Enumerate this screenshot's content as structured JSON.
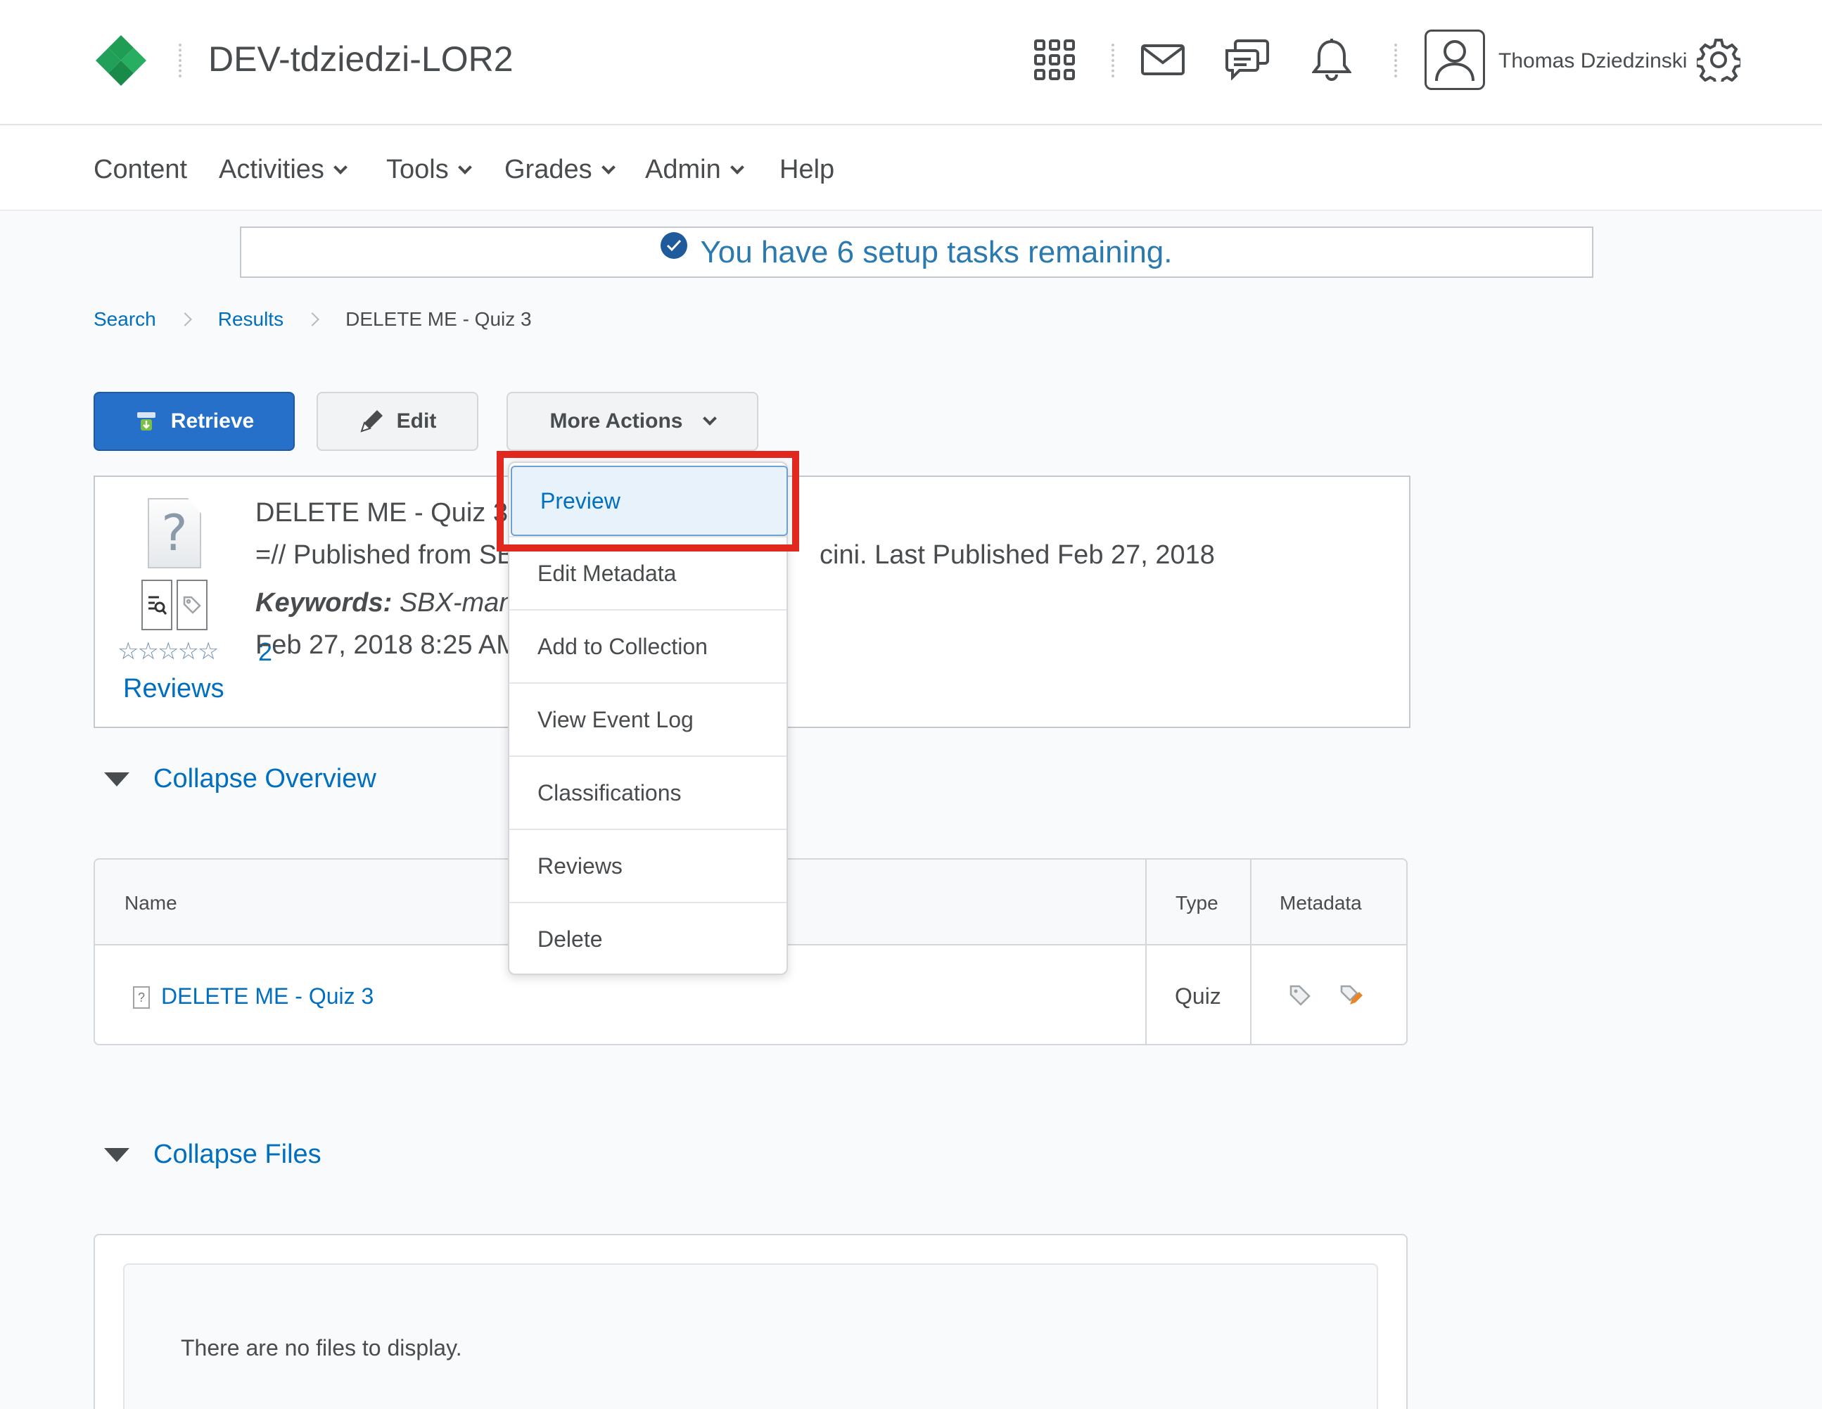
{
  "header": {
    "org_title": "DEV-tdziedzi-LOR2",
    "username": "Thomas Dziedzinski",
    "icons": [
      "waffle-icon",
      "mail-icon",
      "chat-icon",
      "bell-icon",
      "user-icon",
      "gear-icon"
    ]
  },
  "nav": {
    "items": [
      {
        "label": "Content",
        "dropdown": false
      },
      {
        "label": "Activities",
        "dropdown": true
      },
      {
        "label": "Tools",
        "dropdown": true
      },
      {
        "label": "Grades",
        "dropdown": true
      },
      {
        "label": "Admin",
        "dropdown": true
      },
      {
        "label": "Help",
        "dropdown": false
      }
    ]
  },
  "banner": {
    "text": "You have 6 setup tasks remaining."
  },
  "breadcrumb": {
    "items": [
      "Search",
      "Results"
    ],
    "current": "DELETE ME - Quiz 3"
  },
  "actions": {
    "retrieve": "Retrieve",
    "edit": "Edit",
    "more": "More Actions"
  },
  "object": {
    "title": "DELETE ME - Quiz 3",
    "description_start": "=// Published from SB",
    "description_end": "cini. Last Published Feb 27, 2018",
    "keywords_label": "Keywords:",
    "keywords_value": " SBX-manc",
    "date": "Feb 27, 2018 8:25 AM",
    "rating": 0,
    "rating_max": 5,
    "review_count": "2",
    "reviews_label": "Reviews"
  },
  "overview": {
    "toggle_label": "Collapse Overview",
    "columns": [
      "Name",
      "Type",
      "Metadata"
    ],
    "rows": [
      {
        "name": "DELETE ME - Quiz 3",
        "type": "Quiz"
      }
    ]
  },
  "files": {
    "toggle_label": "Collapse Files",
    "empty_text": "There are no files to display."
  },
  "more_actions_menu": {
    "items": [
      "Preview",
      "Edit Metadata",
      "Add to Collection",
      "View Event Log",
      "Classifications",
      "Reviews",
      "Delete"
    ],
    "highlighted": "Preview"
  },
  "colors": {
    "primary": "#2670c9",
    "link": "#006fbf",
    "highlight": "#e0281e",
    "logo": "#1f9d55"
  }
}
